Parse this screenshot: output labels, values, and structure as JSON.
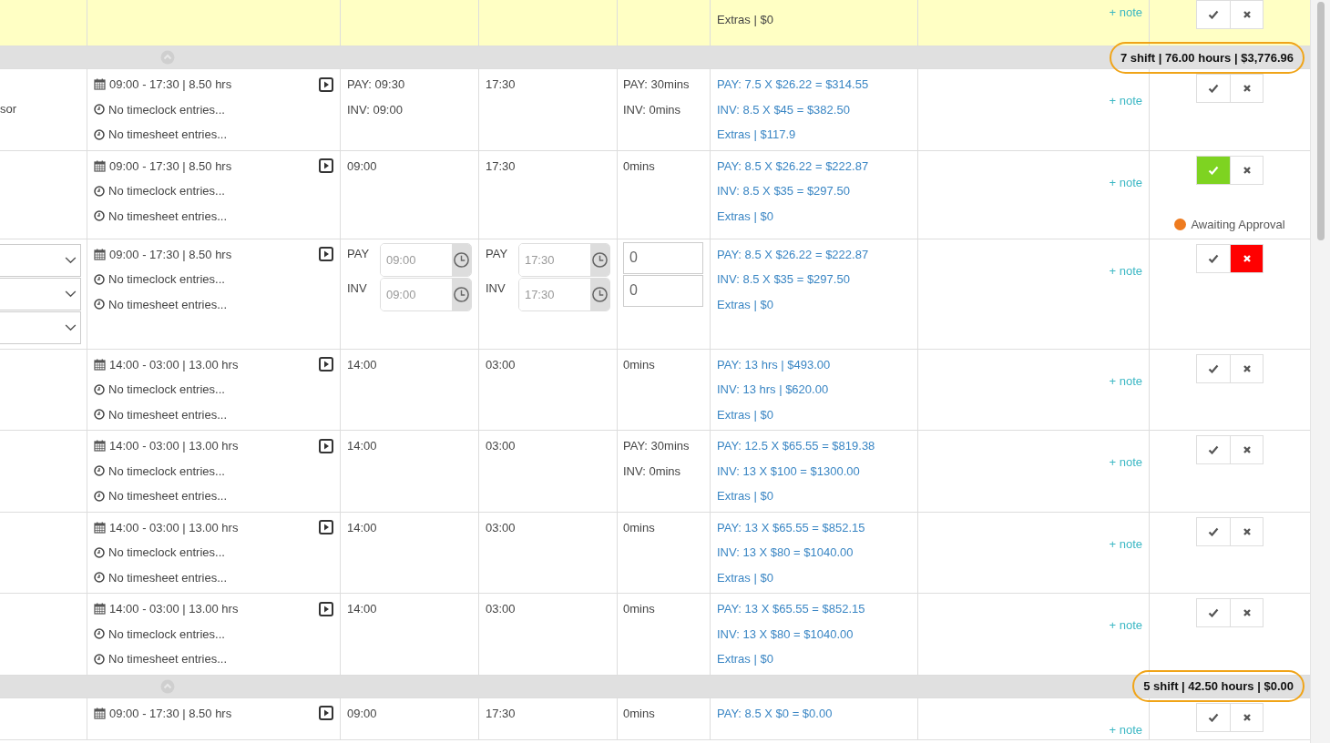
{
  "table": {
    "items": [
      {
        "kind": "shift",
        "highlighted": true,
        "pay": [
          "Extras | $0"
        ],
        "note": "+ note",
        "approve_selected": false,
        "reject_selected": false
      },
      {
        "kind": "group",
        "expanded": true,
        "summary": "7 shift | 76.00 hours | $3,776.96",
        "circled": true
      },
      {
        "kind": "shift",
        "highlighted": false,
        "role": "sor",
        "schedule": "09:00 - 17:30 | 8.50 hrs",
        "timeclock": "No timeclock entries...",
        "timesheet": "No timesheet entries...",
        "start": [
          "PAY: 09:30",
          "INV: 09:00"
        ],
        "end": [
          "17:30"
        ],
        "break": [
          "PAY: 30mins",
          "INV: 0mins"
        ],
        "pay": [
          "PAY: 7.5 X $26.22 = $314.55",
          "INV: 8.5 X $45 = $382.50",
          "Extras | $117.9"
        ],
        "note": "+ note",
        "approve_selected": false,
        "reject_selected": false
      },
      {
        "kind": "shift",
        "highlighted": false,
        "schedule": "09:00 - 17:30 | 8.50 hrs",
        "timeclock": "No timeclock entries...",
        "timesheet": "No timesheet entries...",
        "start": [
          "09:00"
        ],
        "end": [
          "17:30"
        ],
        "break": [
          "0mins"
        ],
        "pay": [
          "PAY: 8.5 X $26.22 = $222.87",
          "INV: 8.5 X $35 = $297.50",
          "Extras | $0"
        ],
        "note": "+ note",
        "approve_selected": true,
        "reject_selected": false,
        "status": {
          "label": "Awaiting Approval",
          "color": "#ee7b1f"
        }
      },
      {
        "kind": "edit",
        "highlighted": false,
        "dropdowns": [
          {
            "expanded": false
          },
          {
            "expanded": false
          },
          {
            "expanded": false
          }
        ],
        "schedule": "09:00 - 17:30 | 8.50 hrs",
        "timeclock": "No timeclock entries...",
        "timesheet": "No timesheet entries...",
        "start_fields": [
          {
            "label": "PAY",
            "placeholder": "09:00"
          },
          {
            "label": "INV",
            "placeholder": "09:00"
          }
        ],
        "end_fields": [
          {
            "label": "PAY",
            "placeholder": "17:30"
          },
          {
            "label": "INV",
            "placeholder": "17:30"
          }
        ],
        "break_inputs": [
          {
            "value": "0"
          },
          {
            "value": "0"
          }
        ],
        "pay": [
          "PAY: 8.5 X $26.22 = $222.87",
          "INV: 8.5 X $35 = $297.50",
          "Extras | $0"
        ],
        "note": "+ note",
        "approve_selected": false,
        "reject_selected": true
      },
      {
        "kind": "shift",
        "highlighted": false,
        "schedule": "14:00 - 03:00 | 13.00 hrs",
        "timeclock": "No timeclock entries...",
        "timesheet": "No timesheet entries...",
        "start": [
          "14:00"
        ],
        "end": [
          "03:00"
        ],
        "break": [
          "0mins"
        ],
        "pay": [
          "PAY: 13 hrs | $493.00",
          "INV: 13 hrs | $620.00",
          "Extras | $0"
        ],
        "note": "+ note",
        "approve_selected": false,
        "reject_selected": false
      },
      {
        "kind": "shift",
        "highlighted": false,
        "schedule": "14:00 - 03:00 | 13.00 hrs",
        "timeclock": "No timeclock entries...",
        "timesheet": "No timesheet entries...",
        "start": [
          "14:00"
        ],
        "end": [
          "03:00"
        ],
        "break": [
          "PAY: 30mins",
          "INV: 0mins"
        ],
        "pay": [
          "PAY: 12.5 X $65.55 = $819.38",
          "INV: 13 X $100 = $1300.00",
          "Extras | $0"
        ],
        "note": "+ note",
        "approve_selected": false,
        "reject_selected": false
      },
      {
        "kind": "shift",
        "highlighted": false,
        "schedule": "14:00 - 03:00 | 13.00 hrs",
        "timeclock": "No timeclock entries...",
        "timesheet": "No timesheet entries...",
        "start": [
          "14:00"
        ],
        "end": [
          "03:00"
        ],
        "break": [
          "0mins"
        ],
        "pay": [
          "PAY: 13 X $65.55 = $852.15",
          "INV: 13 X $80 = $1040.00",
          "Extras | $0"
        ],
        "note": "+ note",
        "approve_selected": false,
        "reject_selected": false
      },
      {
        "kind": "shift",
        "highlighted": false,
        "schedule": "14:00 - 03:00 | 13.00 hrs",
        "timeclock": "No timeclock entries...",
        "timesheet": "No timesheet entries...",
        "start": [
          "14:00"
        ],
        "end": [
          "03:00"
        ],
        "break": [
          "0mins"
        ],
        "pay": [
          "PAY: 13 X $65.55 = $852.15",
          "INV: 13 X $80 = $1040.00",
          "Extras | $0"
        ],
        "note": "+ note",
        "approve_selected": false,
        "reject_selected": false
      },
      {
        "kind": "group",
        "expanded": true,
        "summary": "5 shift | 42.50 hours | $0.00",
        "circled": true
      },
      {
        "kind": "shift",
        "highlighted": false,
        "schedule": "09:00 - 17:30 | 8.50 hrs",
        "start": [
          "09:00"
        ],
        "end": [
          "17:30"
        ],
        "break": [
          "0mins"
        ],
        "pay": [
          "PAY: 8.5 X $0 = $0.00"
        ],
        "note": "+ note",
        "approve_selected": false,
        "reject_selected": false
      }
    ]
  }
}
